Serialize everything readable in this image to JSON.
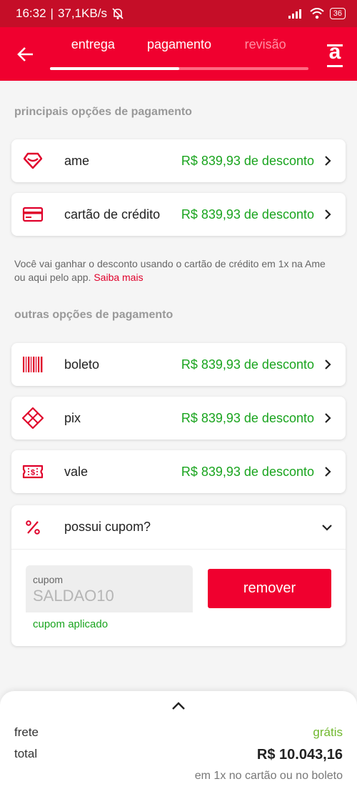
{
  "status": {
    "time": "16:32",
    "speed": "37,1KB/s",
    "battery": "36"
  },
  "header": {
    "steps": [
      "entrega",
      "pagamento",
      "revisão"
    ],
    "progress": 0.5,
    "brand": "a"
  },
  "main": {
    "title": "principais opções de pagamento",
    "options": [
      {
        "label": "ame",
        "discount": "R$ 839,93 de desconto",
        "icon": "ame-heart-icon"
      },
      {
        "label": "cartão de crédito",
        "discount": "R$ 839,93 de desconto",
        "icon": "credit-card-icon"
      }
    ],
    "info_text": "Você vai ganhar o desconto usando o cartão de crédito em 1x na Ame ou aqui pelo app.",
    "info_link": "Saiba mais"
  },
  "other": {
    "title": "outras opções de pagamento",
    "options": [
      {
        "label": "boleto",
        "discount": "R$ 839,93 de desconto",
        "icon": "barcode-icon"
      },
      {
        "label": "pix",
        "discount": "R$ 839,93 de desconto",
        "icon": "pix-icon"
      },
      {
        "label": "vale",
        "discount": "R$ 839,93 de desconto",
        "icon": "voucher-icon"
      }
    ]
  },
  "coupon": {
    "question": "possui cupom?",
    "field_label": "cupom",
    "value": "SALDAO10",
    "status": "cupom aplicado",
    "remove": "remover"
  },
  "summary": {
    "shipping_label": "frete",
    "shipping_value": "grátis",
    "total_label": "total",
    "total_value": "R$ 10.043,16",
    "note": "em 1x no cartão ou no boleto"
  },
  "colors": {
    "primary": "#f0002f",
    "status_bar": "#c50e28",
    "discount": "#19a41e",
    "free": "#70b82e"
  }
}
